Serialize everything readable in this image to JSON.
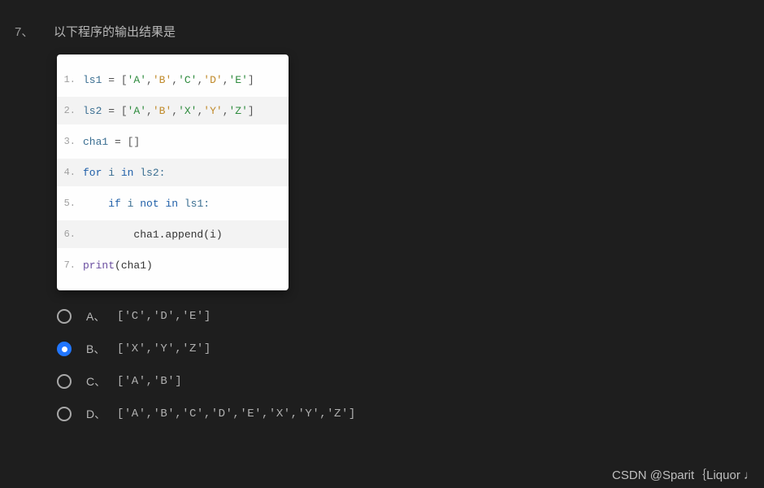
{
  "question": {
    "number": "7、",
    "text": "以下程序的输出结果是"
  },
  "code": {
    "lines": [
      {
        "n": "1.",
        "hl": false,
        "segments": [
          {
            "t": "ls1 ",
            "c": "tok-var"
          },
          {
            "t": "= [",
            "c": "tok-pun"
          },
          {
            "t": "'A'",
            "c": "tok-str"
          },
          {
            "t": ",",
            "c": "tok-pun"
          },
          {
            "t": "'B'",
            "c": "tok-str2"
          },
          {
            "t": ",",
            "c": "tok-pun"
          },
          {
            "t": "'C'",
            "c": "tok-str"
          },
          {
            "t": ",",
            "c": "tok-pun"
          },
          {
            "t": "'D'",
            "c": "tok-str2"
          },
          {
            "t": ",",
            "c": "tok-pun"
          },
          {
            "t": "'E'",
            "c": "tok-str"
          },
          {
            "t": "]",
            "c": "tok-pun"
          }
        ]
      },
      {
        "n": "2.",
        "hl": true,
        "segments": [
          {
            "t": "ls2 ",
            "c": "tok-var"
          },
          {
            "t": "= [",
            "c": "tok-pun"
          },
          {
            "t": "'A'",
            "c": "tok-str"
          },
          {
            "t": ",",
            "c": "tok-pun"
          },
          {
            "t": "'B'",
            "c": "tok-str2"
          },
          {
            "t": ",",
            "c": "tok-pun"
          },
          {
            "t": "'X'",
            "c": "tok-str"
          },
          {
            "t": ",",
            "c": "tok-pun"
          },
          {
            "t": "'Y'",
            "c": "tok-str2"
          },
          {
            "t": ",",
            "c": "tok-pun"
          },
          {
            "t": "'Z'",
            "c": "tok-str"
          },
          {
            "t": "]",
            "c": "tok-pun"
          }
        ]
      },
      {
        "n": "3.",
        "hl": false,
        "segments": [
          {
            "t": "cha1 ",
            "c": "tok-var"
          },
          {
            "t": "= []",
            "c": "tok-pun"
          }
        ]
      },
      {
        "n": "4.",
        "hl": true,
        "segments": [
          {
            "t": "for ",
            "c": "tok-kw"
          },
          {
            "t": "i ",
            "c": "tok-var"
          },
          {
            "t": "in ",
            "c": "tok-kw"
          },
          {
            "t": "ls2:",
            "c": "tok-var"
          }
        ]
      },
      {
        "n": "5.",
        "hl": false,
        "segments": [
          {
            "t": "    ",
            "c": ""
          },
          {
            "t": "if ",
            "c": "tok-kw"
          },
          {
            "t": "i ",
            "c": "tok-var"
          },
          {
            "t": "not in ",
            "c": "tok-kw"
          },
          {
            "t": "ls1:",
            "c": "tok-var"
          }
        ]
      },
      {
        "n": "6.",
        "hl": true,
        "segments": [
          {
            "t": "        cha1.append(i)",
            "c": "tok-num"
          }
        ]
      },
      {
        "n": "7.",
        "hl": false,
        "segments": [
          {
            "t": "print",
            "c": "tok-fn"
          },
          {
            "t": "(cha1)",
            "c": "tok-num"
          }
        ]
      }
    ]
  },
  "options": [
    {
      "letter": "A、",
      "text": "['C','D','E']",
      "selected": false
    },
    {
      "letter": "B、",
      "text": "['X','Y','Z']",
      "selected": true
    },
    {
      "letter": "C、",
      "text": "['A','B']",
      "selected": false
    },
    {
      "letter": "D、",
      "text": "['A','B','C','D','E','X','Y','Z']",
      "selected": false
    }
  ],
  "watermark": "CSDN @Sparit｛Liquor ♩"
}
